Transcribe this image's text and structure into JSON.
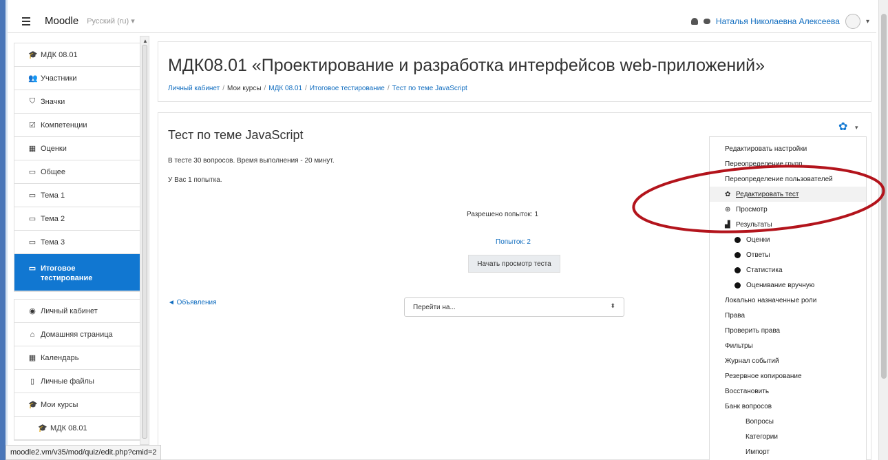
{
  "navbar": {
    "brand": "Moodle",
    "language": "Русский (ru) ▾",
    "user_name": "Наталья Николаевна Алексеева",
    "caret": "▾"
  },
  "drawer": {
    "items": [
      {
        "label": "МДК 08.01",
        "icon": "graduation-cap-icon",
        "glyph": "🎓"
      },
      {
        "label": "Участники",
        "icon": "users-icon",
        "glyph": "👥"
      },
      {
        "label": "Значки",
        "icon": "shield-icon",
        "glyph": "⛉"
      },
      {
        "label": "Компетенции",
        "icon": "checkbox-icon",
        "glyph": "☑"
      },
      {
        "label": "Оценки",
        "icon": "table-icon",
        "glyph": "▦"
      },
      {
        "label": "Общее",
        "icon": "folder-icon",
        "glyph": "▭"
      },
      {
        "label": "Тема 1",
        "icon": "folder-icon",
        "glyph": "▭"
      },
      {
        "label": "Тема 2",
        "icon": "folder-icon",
        "glyph": "▭"
      },
      {
        "label": "Тема 3",
        "icon": "folder-icon",
        "glyph": "▭"
      },
      {
        "label": "Итоговое тестирование",
        "icon": "folder-icon",
        "glyph": "▭",
        "active": true
      }
    ],
    "items2": [
      {
        "label": "Личный кабинет",
        "icon": "dashboard-icon",
        "glyph": "◉"
      },
      {
        "label": "Домашняя страница",
        "icon": "home-icon",
        "glyph": "⌂"
      },
      {
        "label": "Календарь",
        "icon": "calendar-icon",
        "glyph": "▦"
      },
      {
        "label": "Личные файлы",
        "icon": "file-icon",
        "glyph": "▯"
      },
      {
        "label": "Мои курсы",
        "icon": "graduation-cap-icon",
        "glyph": "🎓"
      },
      {
        "label": "МДК 08.01",
        "icon": "graduation-cap-icon",
        "glyph": "🎓",
        "sub": true
      }
    ],
    "active_line1": "Итоговое",
    "active_line2": "тестирование"
  },
  "header": {
    "title": "МДК08.01 «Проектирование и разработка интерфейсов web-приложений»",
    "breadcrumb": [
      "Личный кабинет",
      "Мои курсы",
      "МДК 08.01",
      "Итоговое тестирование",
      "Тест по теме JavaScript"
    ]
  },
  "quiz": {
    "title": "Тест по теме JavaScript",
    "intro_line1": "В тесте 30 вопросов. Время выполнения - 20 минут.",
    "intro_line2": "У Вас 1 попытка.",
    "attempts_allowed": "Разрешено попыток: 1",
    "attempts_link": "Попыток: 2",
    "preview_button": "Начать просмотр теста",
    "prev_activity": "◄ Объявления",
    "jump_placeholder": "Перейти на...",
    "jump_arrows": "⬍"
  },
  "admin_menu": {
    "items": [
      {
        "label": "Редактировать настройки",
        "level": 0
      },
      {
        "label": "Переопределение групп",
        "level": 0
      },
      {
        "label": "Переопределение пользователей",
        "level": 0
      },
      {
        "label": "Редактировать тест",
        "level": 0,
        "icon": "gear-icon",
        "glyph": "✿",
        "hover": true
      },
      {
        "label": "Просмотр",
        "level": 0,
        "icon": "zoom-icon",
        "glyph": "⊕"
      },
      {
        "label": "Результаты",
        "level": 0,
        "icon": "chart-icon",
        "glyph": "▟"
      },
      {
        "label": "Оценки",
        "level": 1,
        "dot": true
      },
      {
        "label": "Ответы",
        "level": 1,
        "dot": true
      },
      {
        "label": "Статистика",
        "level": 1,
        "dot": true
      },
      {
        "label": "Оценивание вручную",
        "level": 1,
        "dot": true
      },
      {
        "label": "Локально назначенные роли",
        "level": 0
      },
      {
        "label": "Права",
        "level": 0
      },
      {
        "label": "Проверить права",
        "level": 0
      },
      {
        "label": "Фильтры",
        "level": 0
      },
      {
        "label": "Журнал событий",
        "level": 0
      },
      {
        "label": "Резервное копирование",
        "level": 0
      },
      {
        "label": "Восстановить",
        "level": 0
      },
      {
        "label": "Банк вопросов",
        "level": 0
      },
      {
        "label": "Вопросы",
        "level": 2
      },
      {
        "label": "Категории",
        "level": 2
      },
      {
        "label": "Импорт",
        "level": 2
      }
    ]
  },
  "statusbar": {
    "url": "moodle2.vm/v35/mod/quiz/edit.php?cmid=2"
  },
  "colors": {
    "accent": "#1177d1",
    "link": "#0f6cbf",
    "annotation": "#b3141c"
  }
}
